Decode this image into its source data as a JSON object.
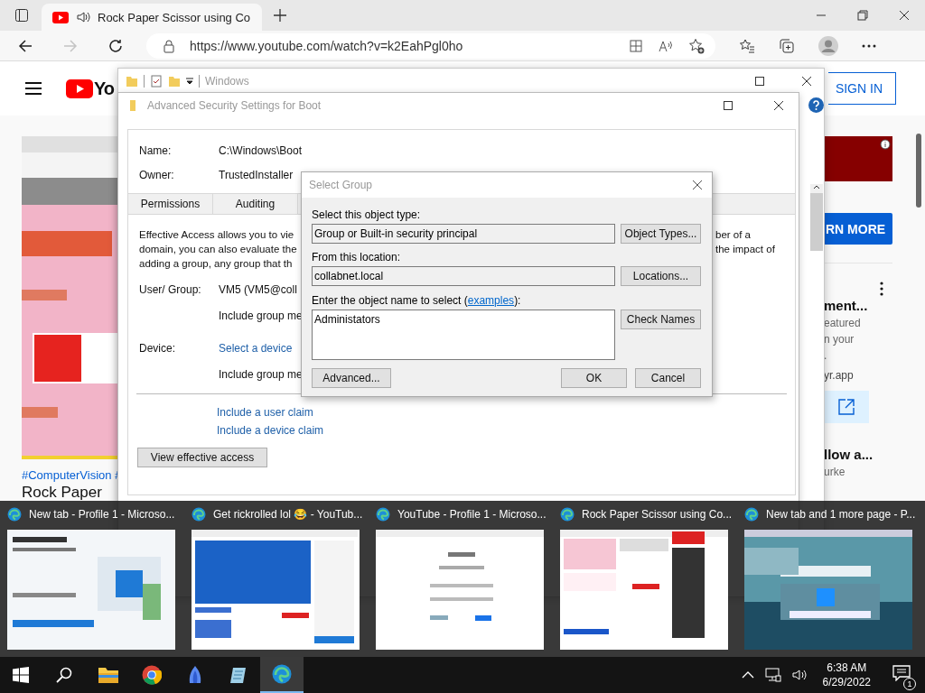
{
  "browser": {
    "tab": {
      "title": "Rock Paper Scissor using Co",
      "selected": true
    },
    "url": "https://www.youtube.com/watch?v=k2EahPgl0ho",
    "forward_disabled": true
  },
  "youtube": {
    "logo": "Yo",
    "sign_in": "SIGN IN",
    "hashtags": "#ComputerVision #",
    "video_title": "Rock Paper",
    "ad_button": "RN MORE",
    "cards": [
      {
        "title": "ment...",
        "lines": [
          "eatured",
          "n your",
          "."
        ],
        "site": "yr.app"
      },
      {
        "title": "llow a...",
        "lines": [
          "urke"
        ]
      }
    ]
  },
  "explorer": {
    "title": "Windows"
  },
  "security": {
    "title": "Advanced Security Settings for Boot",
    "name_label": "Name:",
    "name": "C:\\Windows\\Boot",
    "owner_label": "Owner:",
    "owner": "TrustedInstaller",
    "tabs": [
      {
        "label": "Permissions",
        "selected": false
      },
      {
        "label": "Auditing",
        "selected": false
      }
    ],
    "paragraph": [
      {
        "left": "Effective Access allows you to vie",
        "right": "ber of a"
      },
      {
        "left": "domain, you can also evaluate the",
        "right": "the impact of"
      },
      {
        "left": "adding a group, any group that th"
      }
    ],
    "user_label": "User/ Group:",
    "user": "VM5 (VM5@coll",
    "include_user": "Include group me",
    "device_label": "Device:",
    "device_link": "Select a device",
    "include_device": "Include group me",
    "claims": [
      "Include a user claim",
      "Include a device claim"
    ],
    "view_button": "View effective access"
  },
  "select_group": {
    "title": "Select Group",
    "type_label": "Select this object type:",
    "type": "Group or Built-in security principal",
    "type_button": "Object Types...",
    "location_label": "From this location:",
    "location": "collabnet.local",
    "location_button": "Locations...",
    "enter_label": "Enter the object name to select (",
    "enter_link": "examples",
    "enter_end": "):",
    "names": "Administators",
    "check_button": "Check Names",
    "advanced_button": "Advanced...",
    "ok_button": "OK",
    "cancel_button": "Cancel"
  },
  "thumbnails": [
    {
      "title": "New tab - Profile 1 - Microso..."
    },
    {
      "title": "Get rickrolled lol 😂 - YouTub..."
    },
    {
      "title": "YouTube - Profile 1 - Microso..."
    },
    {
      "title": "Rock Paper Scissor using Co..."
    },
    {
      "title": "New tab and 1 more page - P..."
    }
  ],
  "taskbar": {
    "apps": [
      {
        "kind": "files",
        "selected": false
      },
      {
        "kind": "chrome",
        "selected": false
      },
      {
        "kind": "bird",
        "selected": false
      },
      {
        "kind": "notepad",
        "selected": false
      },
      {
        "kind": "edge",
        "selected": true
      }
    ],
    "time": "6:38 AM",
    "date": "6/29/2022",
    "notifications": "1"
  }
}
